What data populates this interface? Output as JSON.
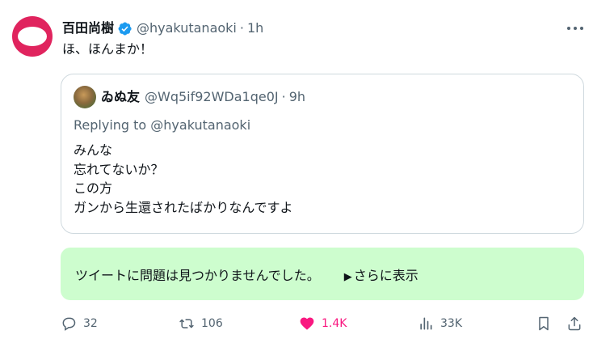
{
  "tweet": {
    "display_name": "百田尚樹",
    "handle": "@hyakutanaoki",
    "separator": "·",
    "time": "1h",
    "text": "ほ、ほんまか！",
    "verified_icon": "verified-badge-icon",
    "colors": {
      "avatar": "#e0245e",
      "verified": "#1d9bf0",
      "like": "#f91880",
      "note_bg": "#cdfdce"
    }
  },
  "quote": {
    "display_name": "ゐぬ友",
    "handle": "@Wq5if92WDa1qe0J",
    "separator": "·",
    "time": "9h",
    "replying_to": "Replying to @hyakutanaoki",
    "lines": [
      "みんな",
      "忘れてないか？",
      "この方",
      "ガンから生還されたばかりなんですよ"
    ]
  },
  "note": {
    "text": "ツイートに問題は見つかりませんでした。",
    "more_arrow": "▶",
    "more_label": "さらに表示"
  },
  "actions": {
    "replies": "32",
    "retweets": "106",
    "likes": "1.4K",
    "views": "33K"
  }
}
